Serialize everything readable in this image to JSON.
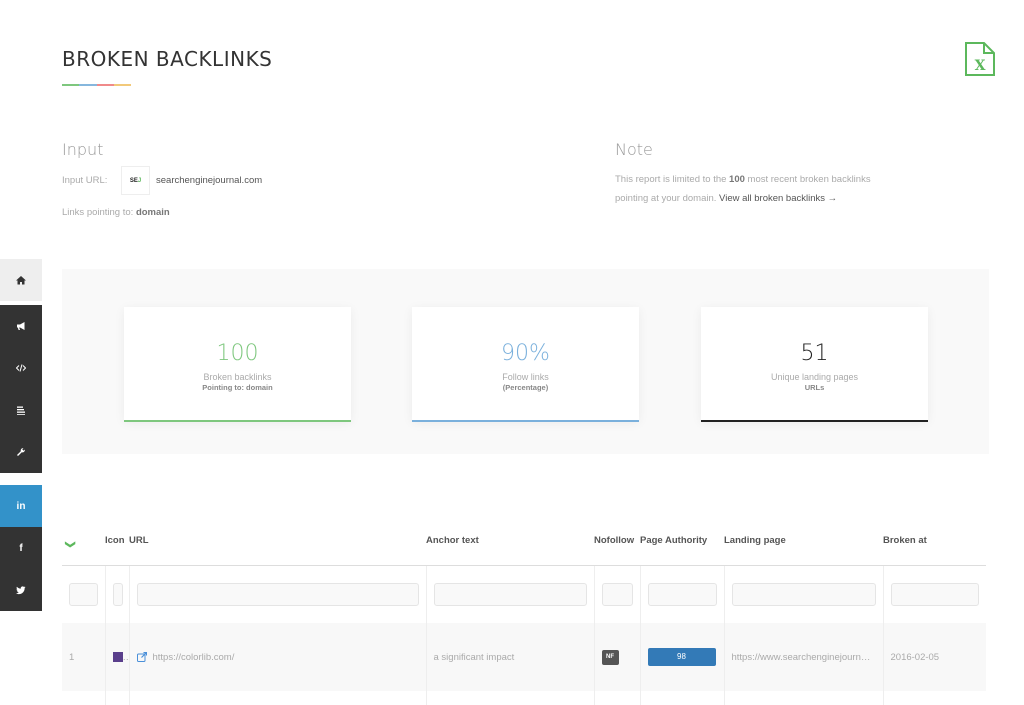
{
  "header": {
    "title": "BROKEN BACKLINKS",
    "underline_colors": [
      "#7ec77e",
      "#86b7dd",
      "#f08a8a",
      "#f2c97a"
    ],
    "export_icon": "excel-file-icon",
    "export_color": "#5cb85c"
  },
  "input": {
    "heading": "Input",
    "url_label": "Input URL:",
    "logo_text": "SE",
    "logo_accent": "J",
    "url_value": "searchenginejournal.com",
    "links_label": "Links pointing to:",
    "links_value": "domain"
  },
  "note": {
    "heading": "Note",
    "text_before": "This report is limited to the ",
    "limit": "100",
    "text_after": " most recent broken backlinks pointing at your domain. ",
    "link_label": "View all broken backlinks →"
  },
  "sidebar": {
    "groups": [
      [
        {
          "icon": "home-icon",
          "bg": "#eeeeee",
          "fg": "#333333"
        }
      ],
      [
        {
          "icon": "megaphone-icon",
          "bg": "#333333",
          "fg": "#ffffff"
        },
        {
          "icon": "code-icon",
          "bg": "#333333",
          "fg": "#ffffff"
        },
        {
          "icon": "list-icon",
          "bg": "#333333",
          "fg": "#ffffff"
        },
        {
          "icon": "wrench-icon",
          "bg": "#333333",
          "fg": "#ffffff"
        }
      ],
      [
        {
          "icon": "linkedin-icon",
          "label": "in",
          "bg": "#3392c9",
          "fg": "#ffffff"
        },
        {
          "icon": "facebook-icon",
          "label": "f",
          "bg": "#333333",
          "fg": "#ffffff"
        },
        {
          "icon": "twitter-icon",
          "bg": "#333333",
          "fg": "#ffffff"
        }
      ]
    ]
  },
  "stats": [
    {
      "value": "100",
      "label": "Broken backlinks",
      "sub": "Pointing to: domain",
      "color": "#7ec77e"
    },
    {
      "value": "90%",
      "label": "Follow links",
      "sub": "(Percentage)",
      "color": "#7ab0dc"
    },
    {
      "value": "51",
      "label": "Unique landing pages",
      "sub": "URLs",
      "color": "#222222"
    }
  ],
  "table": {
    "columns": [
      "",
      "Icon",
      "URL",
      "Anchor text",
      "Nofollow",
      "Page Authority",
      "Landing page",
      "Broken at"
    ],
    "rows": [
      {
        "index": "1",
        "url": "https://colorlib.com/",
        "anchor": "a significant impact",
        "nofollow": "NF",
        "page_authority": "98",
        "landing_page": "https://www.searchenginejournal.com/",
        "broken_at": "2016-02-05"
      }
    ]
  }
}
